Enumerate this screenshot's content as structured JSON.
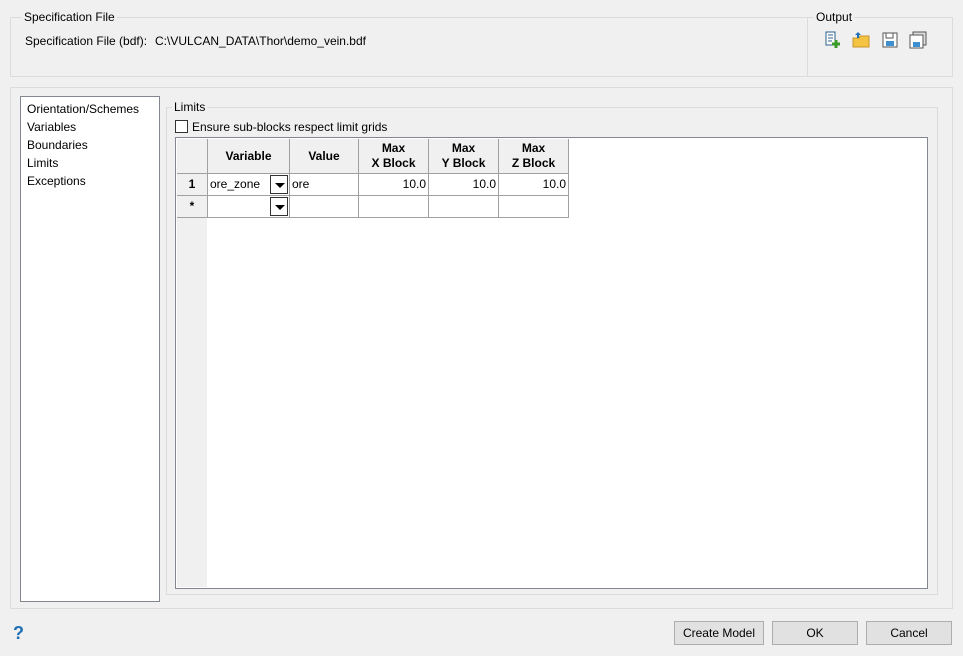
{
  "spec_group": {
    "title": "Specification File",
    "label": "Specification File (bdf):",
    "path": "C:\\VULCAN_DATA\\Thor\\demo_vein.bdf"
  },
  "output_group": {
    "title": "Output",
    "icons": [
      "new-file-icon",
      "open-folder-icon",
      "save-icon",
      "save-as-icon"
    ]
  },
  "nav": {
    "items": [
      "Orientation/Schemes",
      "Variables",
      "Boundaries",
      "Limits",
      "Exceptions"
    ],
    "selected": "Limits"
  },
  "limits": {
    "title": "Limits",
    "checkbox_label": "Ensure sub-blocks respect limit grids",
    "checkbox_checked": false,
    "columns": [
      "Variable",
      "Value",
      "Max\nX Block",
      "Max\nY Block",
      "Max\nZ Block"
    ],
    "rows": [
      {
        "header": "1",
        "variable": "ore_zone",
        "value": "ore",
        "max_x": "10.0",
        "max_y": "10.0",
        "max_z": "10.0"
      },
      {
        "header": "*",
        "variable": "",
        "value": "",
        "max_x": "",
        "max_y": "",
        "max_z": ""
      }
    ]
  },
  "buttons": {
    "help": "?",
    "create": "Create Model",
    "ok": "OK",
    "cancel": "Cancel"
  }
}
